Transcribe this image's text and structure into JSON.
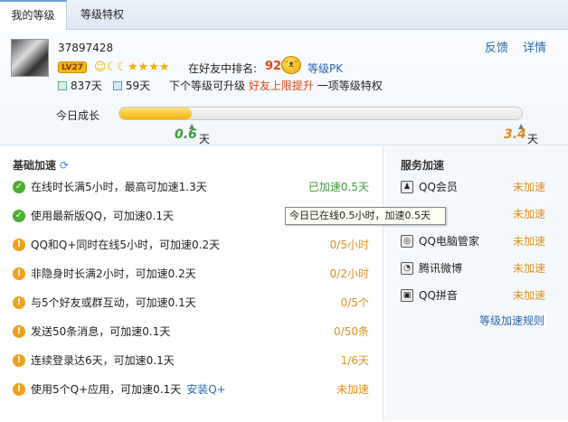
{
  "tabs": [
    "我的等级",
    "等级特权"
  ],
  "user": {
    "qq": "37897428",
    "level_badge": "LV27"
  },
  "header_links": {
    "feedback": "反馈",
    "detail": "详情"
  },
  "rank": {
    "label": "在好友中排名:",
    "value": "92",
    "pk": "等级PK"
  },
  "stats": {
    "days_active": "837天",
    "days_rest": "59天",
    "next_prefix": "下个等级可升级",
    "next_highlight": "好友上限提升",
    "next_suffix": "一项等级特权"
  },
  "growth": {
    "label": "今日成长",
    "progress": 0.18,
    "current": "0.6",
    "max": "3.4",
    "unit": "天"
  },
  "basic": {
    "title": "基础加速",
    "rows": [
      {
        "icon": "check",
        "text": "在线时长满5小时，最高可加速1.3天",
        "status": "已加速0.5天",
        "done": true
      },
      {
        "icon": "check",
        "text": "使用最新版QQ，可加速0.1天",
        "status": "",
        "done": true
      },
      {
        "icon": "warn",
        "text": "QQ和Q+同时在线5小时，可加速0.2天",
        "status": "0/5小时",
        "done": false
      },
      {
        "icon": "warn",
        "text": "非隐身时长满2小时，可加速0.2天",
        "status": "0/2小时",
        "done": false
      },
      {
        "icon": "warn",
        "text": "与5个好友或群互动，可加速0.1天",
        "status": "0/5个",
        "done": false
      },
      {
        "icon": "warn",
        "text": "发送50条消息，可加速0.1天",
        "status": "0/50条",
        "done": false
      },
      {
        "icon": "warn",
        "text": "连续登录达6天，可加速0.1天",
        "status": "1/6天",
        "done": false
      },
      {
        "icon": "warn",
        "text": "使用5个Q+应用，可加速0.1天",
        "status": "未加速",
        "done": false,
        "extra": "安装Q+"
      }
    ]
  },
  "service": {
    "title": "服务加速",
    "rows": [
      {
        "name": "QQ会员",
        "status": "未加速"
      },
      {
        "name": "QQ",
        "status": "未加速"
      },
      {
        "name": "QQ电脑管家",
        "status": "未加速"
      },
      {
        "name": "腾讯微博",
        "status": "未加速"
      },
      {
        "name": "QQ拼音",
        "status": "未加速"
      }
    ],
    "rule_link": "等级加速规则"
  },
  "tooltip": "今日已在线0.5小时，加速0.5天"
}
